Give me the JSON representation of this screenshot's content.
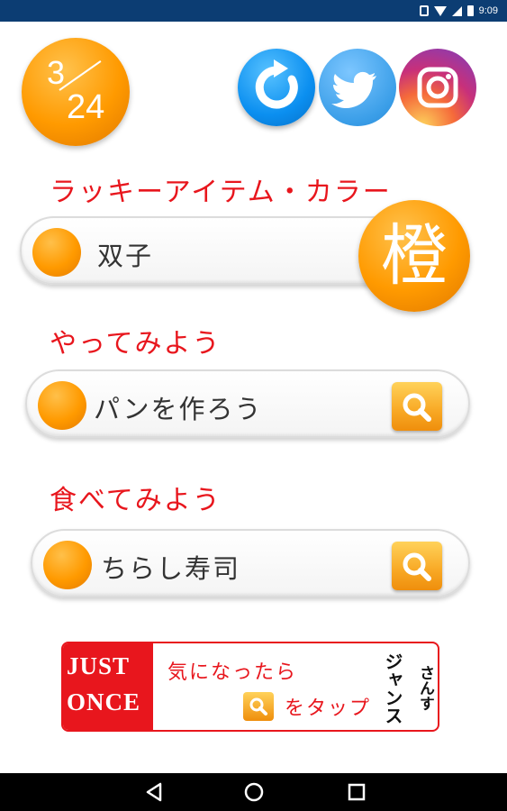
{
  "status_bar": {
    "time": "9:09"
  },
  "date_badge": {
    "month": "3",
    "day": "24"
  },
  "social": {
    "refresh": "refresh-icon",
    "twitter": "twitter-icon",
    "instagram": "instagram-icon"
  },
  "lucky": {
    "title": "ラッキーアイテム・カラー",
    "item": "双子",
    "color_char": "橙"
  },
  "try": {
    "title": "やってみよう",
    "item": "パンを作ろう"
  },
  "eat": {
    "title": "食べてみよう",
    "item": "ちらし寿司"
  },
  "banner": {
    "logo_line1": "JUST",
    "logo_line2": "ONCE",
    "line1": "気になったら",
    "line2": "をタップ",
    "manga1": "ジャンス",
    "manga2": "さんす"
  },
  "colors": {
    "accent_orange": "#ff9a00",
    "title_red": "#e8161d",
    "status_bar": "#0c3d73"
  }
}
